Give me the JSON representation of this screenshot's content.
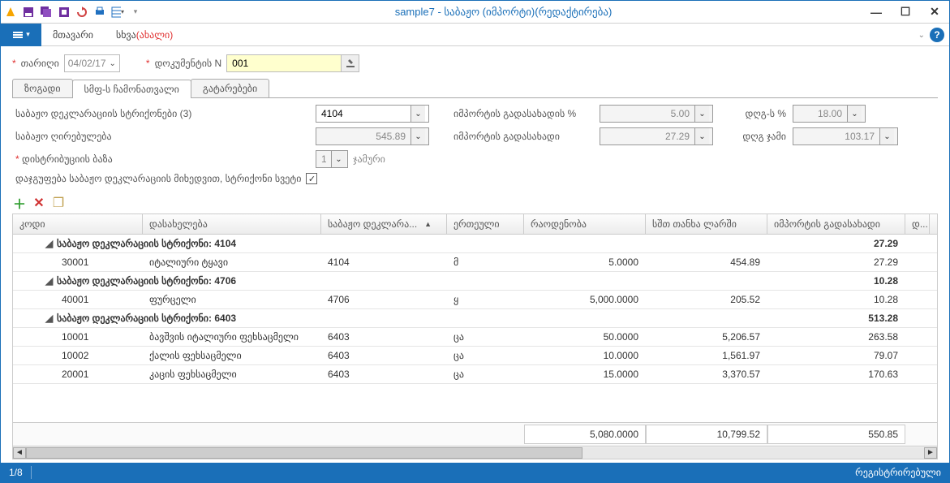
{
  "window_title": "sample7 - საბაჟო (იმპორტი)(რედაქტირება)",
  "ribbon": {
    "main": "მთავარი",
    "other": "სხვა",
    "other_new": "(ახალი)"
  },
  "header": {
    "date_label": "თარიღი",
    "date_value": "04/02/17",
    "docn_label": "დოკუმენტის N",
    "docn_value": "001"
  },
  "tabs": {
    "general": "ზოგადი",
    "smf": "სმფ-ს ჩამონათვალი",
    "transactions": "გატარებები"
  },
  "form": {
    "lines_label": "საბაჟო დეკლარაციის სტრიქონები (3)",
    "lines_value": "4104",
    "import_tax_pct_label": "იმპორტის გადასახადის %",
    "import_tax_pct_value": "5.00",
    "vat_pct_label": "დღგ-ს %",
    "vat_pct_value": "18.00",
    "customs_value_label": "საბაჟო ღირებულება",
    "customs_value_value": "545.89",
    "import_tax_label": "იმპორტის გადასახადი",
    "import_tax_value": "27.29",
    "vat_sum_label": "დღგ ჯამი",
    "vat_sum_value": "103.17",
    "dist_base_label": "დისტრიბუციის ბაზა",
    "dist_base_value": "1",
    "dist_base_unit": "ჯამური",
    "group_label": "დაჯგუფება საბაჟო დეკლარაციის მიხედვით, სტრიქონი სვეტი"
  },
  "grid": {
    "columns": {
      "code": "კოდი",
      "name": "დასახელება",
      "decl": "საბაჟო დეკლარა...",
      "unit": "ერთეული",
      "qty": "რაოდენობა",
      "amount": "სშთ თანხა ლარში",
      "tax": "იმპორტის გადასახადი",
      "vat": "დ..."
    },
    "groups": [
      {
        "title": "საბაჟო დეკლარაციის სტრიქონი: 4104",
        "sum_tax": "27.29",
        "rows": [
          {
            "code": "30001",
            "name": "იტალიური ტყავი",
            "decl": "4104",
            "unit": "მ",
            "qty": "5.0000",
            "amount": "454.89",
            "tax": "27.29"
          }
        ]
      },
      {
        "title": "საბაჟო დეკლარაციის სტრიქონი: 4706",
        "sum_tax": "10.28",
        "rows": [
          {
            "code": "40001",
            "name": "ფურცელი",
            "decl": "4706",
            "unit": "ყ",
            "qty": "5,000.0000",
            "amount": "205.52",
            "tax": "10.28"
          }
        ]
      },
      {
        "title": "საბაჟო დეკლარაციის სტრიქონი: 6403",
        "sum_tax": "513.28",
        "rows": [
          {
            "code": "10001",
            "name": "ბავშვის იტალიური ფეხსაცმელი",
            "decl": "6403",
            "unit": "ცა",
            "qty": "50.0000",
            "amount": "5,206.57",
            "tax": "263.58"
          },
          {
            "code": "10002",
            "name": "ქალის ფეხსაცმელი",
            "decl": "6403",
            "unit": "ცა",
            "qty": "10.0000",
            "amount": "1,561.97",
            "tax": "79.07"
          },
          {
            "code": "20001",
            "name": "კაცის ფეხსაცმელი",
            "decl": "6403",
            "unit": "ცა",
            "qty": "15.0000",
            "amount": "3,370.57",
            "tax": "170.63"
          }
        ]
      }
    ],
    "totals": {
      "qty": "5,080.0000",
      "amount": "10,799.52",
      "tax": "550.85"
    }
  },
  "status": {
    "page": "1/8",
    "registered": "რეგისტრირებული"
  }
}
